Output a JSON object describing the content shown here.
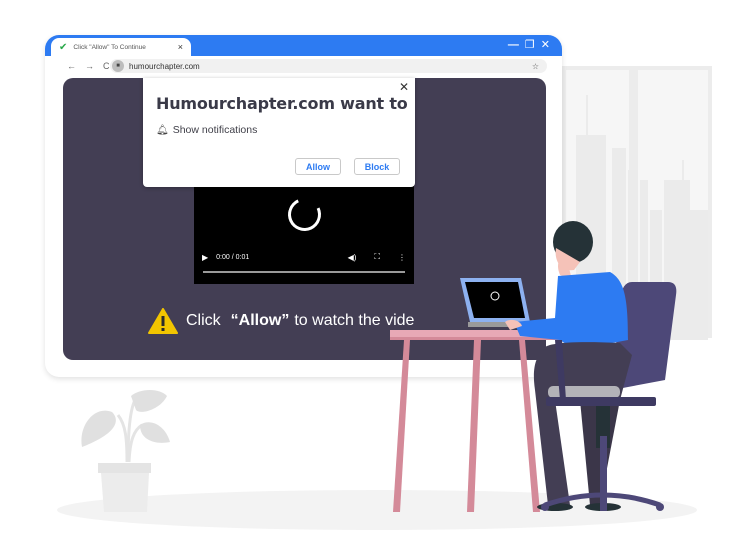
{
  "browser": {
    "tab_title": "Click \"Allow\" To Continue",
    "tab_icon": "checkmark-icon",
    "tab_close": "×",
    "window_controls": {
      "minimize": "—",
      "restore": "❐",
      "close": "✕"
    },
    "nav": {
      "back": "←",
      "forward": "→",
      "reload": "C"
    },
    "url": "humourchapter.com",
    "bookmark_icon": "☆"
  },
  "popup": {
    "title": "Humourchapter.com want to",
    "permission": "Show notifications",
    "close": "✕",
    "allow_label": "Allow",
    "block_label": "Block",
    "accent_color": "#2d7bf2"
  },
  "video": {
    "time": "0:00 / 0:01",
    "play_icon": "▶",
    "volume_icon": "🔊",
    "fullscreen_icon": "⛶",
    "more_icon": "⋮",
    "progress": 0
  },
  "instruction": {
    "prefix": "Click",
    "highlight": "“Allow”",
    "suffix": "to watch the vide"
  },
  "colors": {
    "titlebar": "#2d7bf2",
    "content_bg": "#433e54",
    "warning": "#f2c500"
  }
}
